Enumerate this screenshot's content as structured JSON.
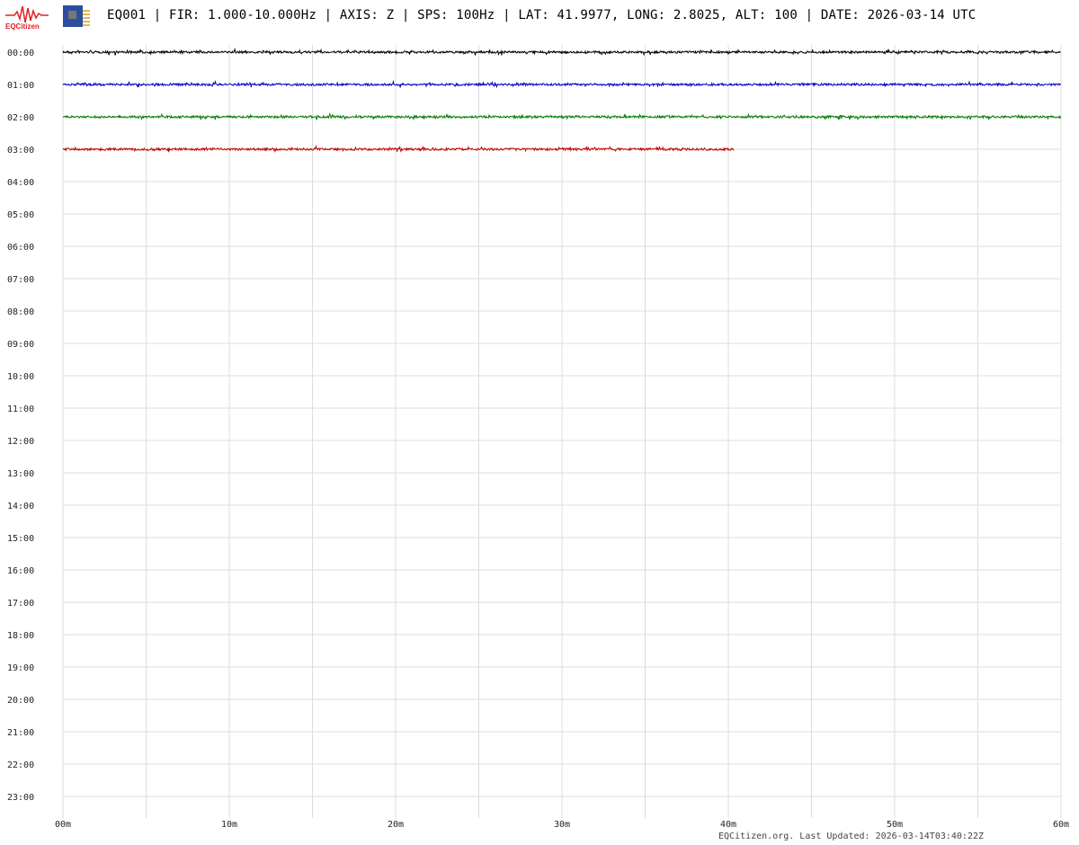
{
  "header": {
    "logo_text": "EQCitizen",
    "title": "EQ001 | FIR: 1.000-10.000Hz | AXIS: Z | SPS: 100Hz | LAT: 41.9977, LONG: 2.8025, ALT: 100 | DATE: 2026-03-14 UTC"
  },
  "footer": {
    "text": "EQCitizen.org. Last Updated: 2026-03-14T03:40:22Z"
  },
  "chart_data": {
    "type": "line",
    "title": "EQ001 | FIR: 1.000-10.000Hz | AXIS: Z | SPS: 100Hz | LAT: 41.9977, LONG: 2.8025, ALT: 100 | DATE: 2026-03-14 UTC",
    "y_tick_labels": [
      "00:00",
      "01:00",
      "02:00",
      "03:00",
      "04:00",
      "05:00",
      "06:00",
      "07:00",
      "08:00",
      "09:00",
      "10:00",
      "11:00",
      "12:00",
      "13:00",
      "14:00",
      "15:00",
      "16:00",
      "17:00",
      "18:00",
      "19:00",
      "20:00",
      "21:00",
      "22:00",
      "23:00"
    ],
    "x_tick_labels": [
      "00m",
      "10m",
      "20m",
      "30m",
      "40m",
      "50m",
      "60m"
    ],
    "x_ticks": [
      0,
      10,
      20,
      30,
      40,
      50,
      60
    ],
    "xlim": [
      0,
      60
    ],
    "grid": true,
    "series": [
      {
        "name": "00:00",
        "color": "#000000",
        "x_end_minutes": 60
      },
      {
        "name": "01:00",
        "color": "#0000c0",
        "x_end_minutes": 60
      },
      {
        "name": "02:00",
        "color": "#008000",
        "x_end_minutes": 60
      },
      {
        "name": "03:00",
        "color": "#c00000",
        "x_end_minutes": 40.37
      }
    ]
  }
}
